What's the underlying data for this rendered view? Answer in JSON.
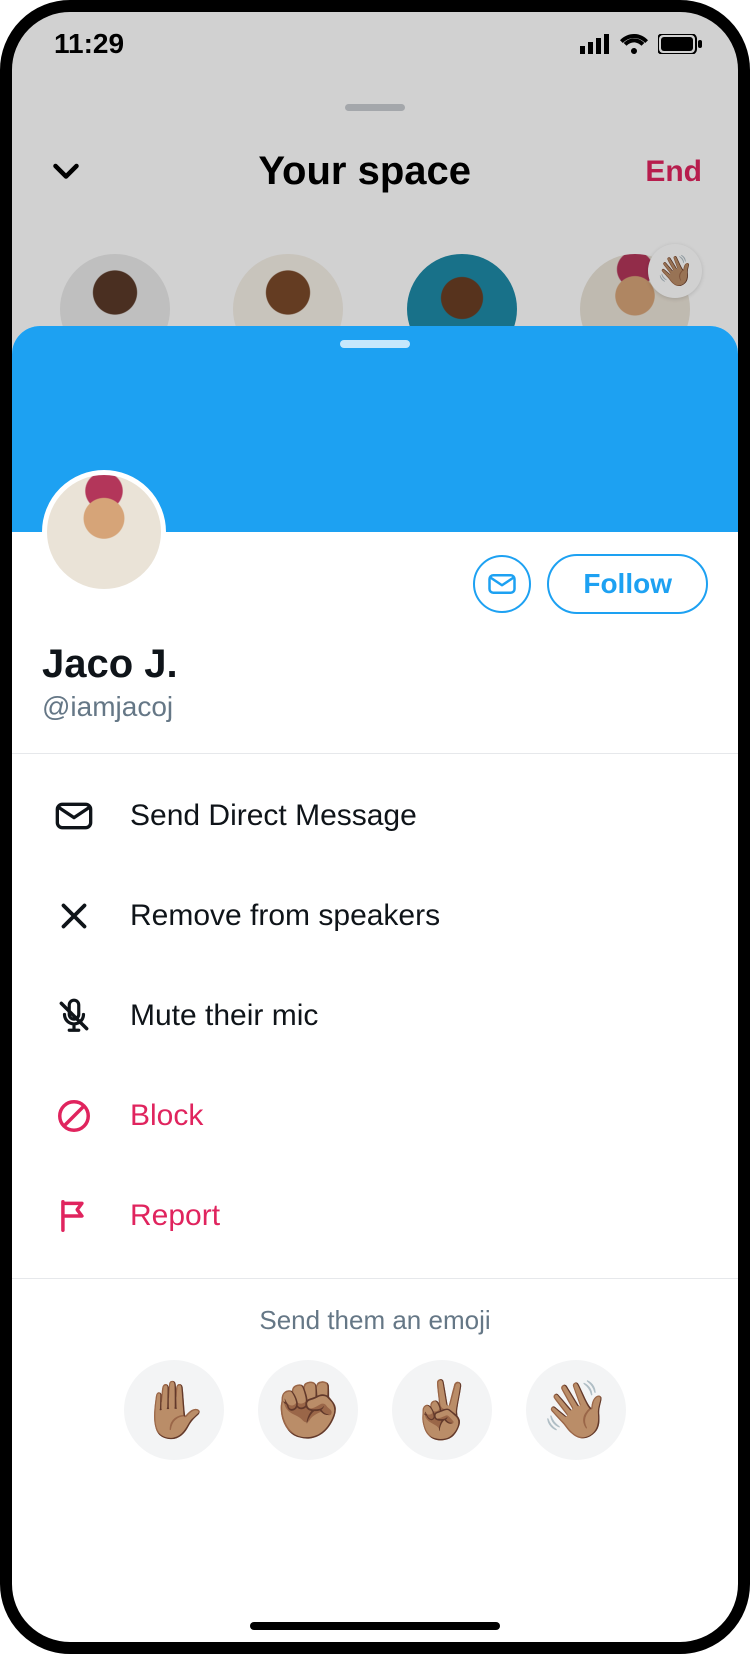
{
  "status": {
    "time": "11:29"
  },
  "space": {
    "title": "Your space",
    "end_label": "End",
    "wave_emoji": "👋🏽"
  },
  "profile": {
    "display_name": "Jaco J.",
    "handle": "@iamjacoj",
    "follow_label": "Follow"
  },
  "menu": {
    "dm": "Send Direct Message",
    "remove": "Remove from speakers",
    "mute": "Mute their mic",
    "block": "Block",
    "report": "Report"
  },
  "emoji_section": {
    "label": "Send them an emoji",
    "options": [
      "✋🏽",
      "✊🏽",
      "✌🏽",
      "👋🏽"
    ]
  }
}
